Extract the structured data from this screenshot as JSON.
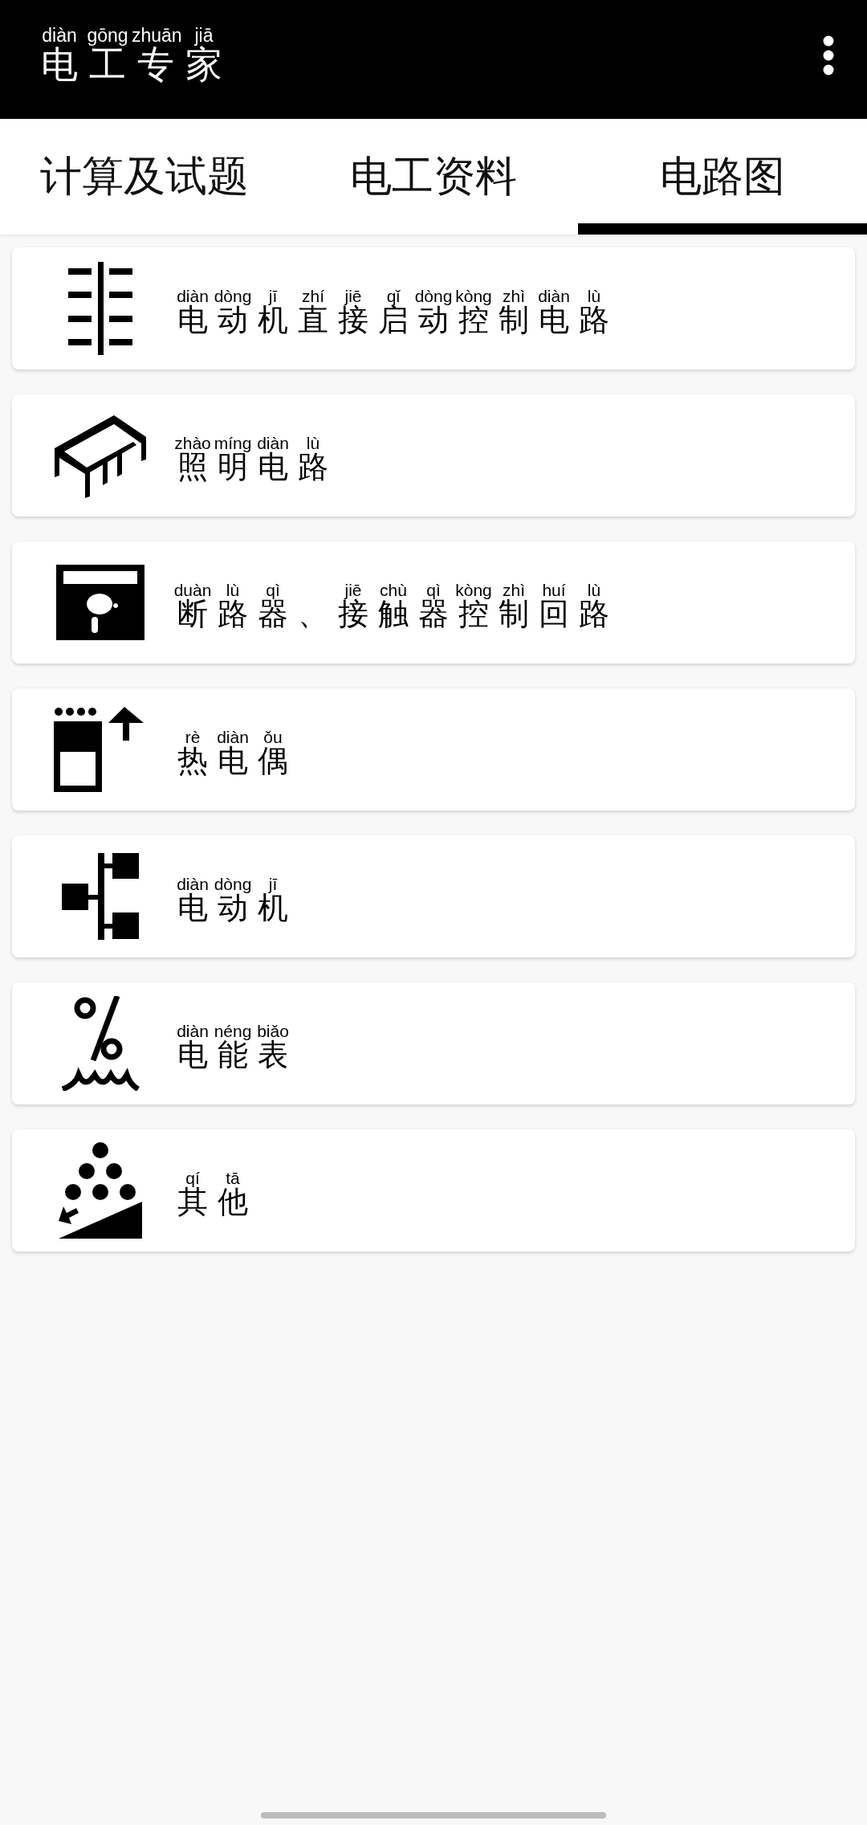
{
  "app_bar": {
    "title": [
      {
        "char": "电",
        "pinyin": "diàn"
      },
      {
        "char": "工",
        "pinyin": "gōng"
      },
      {
        "char": "专",
        "pinyin": "zhuān"
      },
      {
        "char": "家",
        "pinyin": "jiā"
      }
    ]
  },
  "tabs": [
    {
      "label": "计算及试题",
      "selected": false
    },
    {
      "label": "电工资料",
      "selected": false
    },
    {
      "label": "电路图",
      "selected": true
    }
  ],
  "items": [
    {
      "title": [
        {
          "char": "电",
          "pinyin": "diàn"
        },
        {
          "char": "动",
          "pinyin": "dòng"
        },
        {
          "char": "机",
          "pinyin": "jī"
        },
        {
          "char": "直",
          "pinyin": "zhí"
        },
        {
          "char": "接",
          "pinyin": "jiē"
        },
        {
          "char": "启",
          "pinyin": "qǐ"
        },
        {
          "char": "动",
          "pinyin": "dòng"
        },
        {
          "char": "控",
          "pinyin": "kòng"
        },
        {
          "char": "制",
          "pinyin": "zhì"
        },
        {
          "char": "电",
          "pinyin": "diàn"
        },
        {
          "char": "路",
          "pinyin": "lù"
        }
      ]
    },
    {
      "title": [
        {
          "char": "照",
          "pinyin": "zhào"
        },
        {
          "char": "明",
          "pinyin": "míng"
        },
        {
          "char": "电",
          "pinyin": "diàn"
        },
        {
          "char": "路",
          "pinyin": "lù"
        }
      ]
    },
    {
      "title": [
        {
          "char": "断",
          "pinyin": "duàn"
        },
        {
          "char": "路",
          "pinyin": "lù"
        },
        {
          "char": "器",
          "pinyin": "qì"
        },
        {
          "char": "、"
        },
        {
          "char": "接",
          "pinyin": "jiē"
        },
        {
          "char": "触",
          "pinyin": "chù"
        },
        {
          "char": "器",
          "pinyin": "qì"
        },
        {
          "char": "控",
          "pinyin": "kòng"
        },
        {
          "char": "制",
          "pinyin": "zhì"
        },
        {
          "char": "回",
          "pinyin": "huí"
        },
        {
          "char": "路",
          "pinyin": "lù"
        }
      ]
    },
    {
      "title": [
        {
          "char": "热",
          "pinyin": "rè"
        },
        {
          "char": "电",
          "pinyin": "diàn"
        },
        {
          "char": "偶",
          "pinyin": "ǒu"
        }
      ]
    },
    {
      "title": [
        {
          "char": "电",
          "pinyin": "diàn"
        },
        {
          "char": "动",
          "pinyin": "dòng"
        },
        {
          "char": "机",
          "pinyin": "jī"
        }
      ]
    },
    {
      "title": [
        {
          "char": "电",
          "pinyin": "diàn"
        },
        {
          "char": "能",
          "pinyin": "néng"
        },
        {
          "char": "表",
          "pinyin": "biǎo"
        }
      ]
    },
    {
      "title": [
        {
          "char": "其",
          "pinyin": "qí"
        },
        {
          "char": "他",
          "pinyin": "tā"
        }
      ]
    }
  ]
}
